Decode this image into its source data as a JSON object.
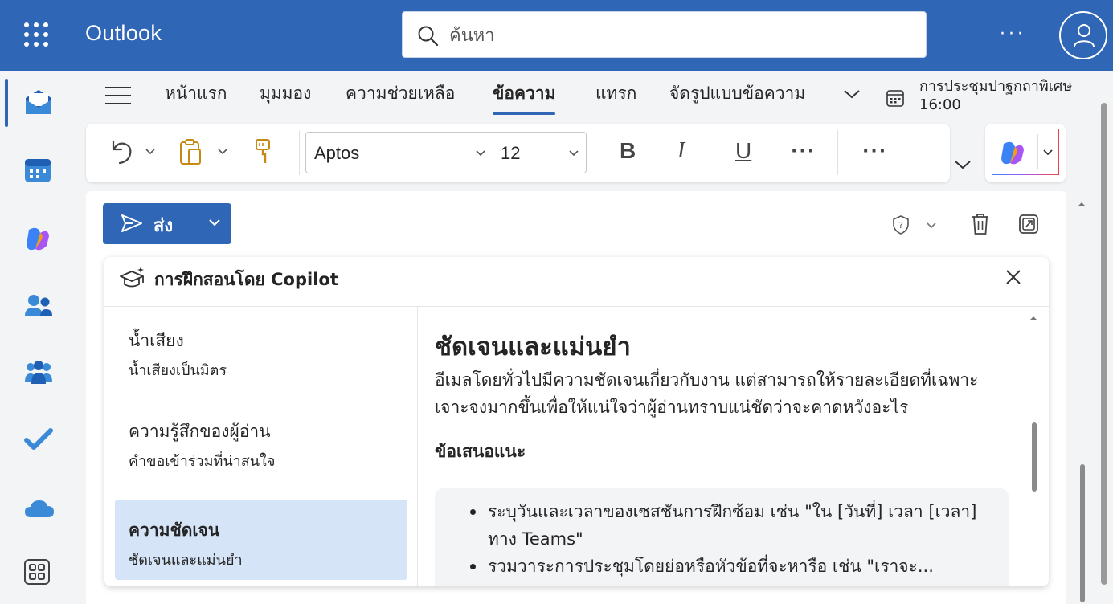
{
  "app": {
    "title": "Outlook"
  },
  "search": {
    "placeholder": "ค้นหา"
  },
  "topbar": {
    "more": "···"
  },
  "ribbon": {
    "tabs": [
      {
        "label": "หน้าแรก",
        "active": false
      },
      {
        "label": "มุมมอง",
        "active": false
      },
      {
        "label": "ความช่วยเหลือ",
        "active": false
      },
      {
        "label": "ข้อความ",
        "active": true
      },
      {
        "label": "แทรก",
        "active": false
      },
      {
        "label": "จัดรูปแบบข้อความ",
        "active": false
      }
    ],
    "meeting": {
      "title": "การประชุมปาฐกถาพิเศษ",
      "time": "16:00"
    }
  },
  "toolbar": {
    "font_name": "Aptos",
    "font_size": "12",
    "bold": "B",
    "italic": "I",
    "underline": "U",
    "more1": "···",
    "more2": "···"
  },
  "compose": {
    "send_label": "ส่ง"
  },
  "coaching": {
    "title": "การฝึกสอนโดย Copilot",
    "categories": [
      {
        "title": "น้ำเสียง",
        "subtitle": "น้ำเสียงเป็นมิตร",
        "selected": false
      },
      {
        "title": "ความรู้สึกของผู้อ่าน",
        "subtitle": "คำขอเข้าร่วมที่น่าสนใจ",
        "selected": false
      },
      {
        "title": "ความชัดเจน",
        "subtitle": "ชัดเจนและแม่นยำ",
        "selected": true
      }
    ],
    "detail": {
      "title": "ชัดเจนและแม่นยำ",
      "description": "อีเมลโดยทั่วไปมีความชัดเจนเกี่ยวกับงาน แต่สามารถให้รายละเอียดที่เฉพาะเจาะจงมากขึ้นเพื่อให้แน่ใจว่าผู้อ่านทราบแน่ชัดว่าจะคาดหวังอะไร",
      "suggestions_label": "ข้อเสนอแนะ",
      "suggestions": [
        "ระบุวันและเวลาของเซสชันการฝึกซ้อม เช่น \"ใน [วันที่] เวลา [เวลา] ทาง Teams\"",
        "รวมวาระการประชุมโดยย่อหรือหัวข้อที่จะหารือ เช่น \"เราจะ..."
      ]
    }
  },
  "colors": {
    "brand": "#2f66b5",
    "selected_bg": "#d6e4f7"
  },
  "icons": {
    "rail": [
      "mail-icon",
      "calendar-icon",
      "copilot-icon",
      "people-icon",
      "teams-icon",
      "todo-icon",
      "onedrive-icon",
      "apps-icon"
    ]
  }
}
